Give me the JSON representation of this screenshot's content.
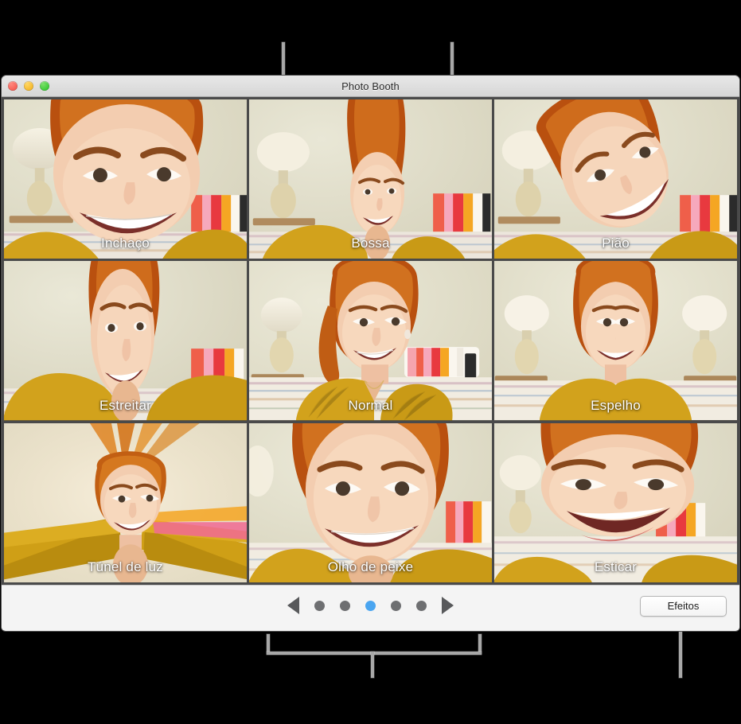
{
  "window": {
    "title": "Photo Booth",
    "controls": [
      "close",
      "minimize",
      "maximize"
    ]
  },
  "effects": [
    {
      "label": "Inchaço",
      "position": "row1-col1",
      "selected": false
    },
    {
      "label": "Bossa",
      "position": "row1-col2",
      "selected": false
    },
    {
      "label": "Pião",
      "position": "row1-col3",
      "selected": false
    },
    {
      "label": "Estreitar",
      "position": "row2-col1",
      "selected": false
    },
    {
      "label": "Normal",
      "position": "row2-col2",
      "selected": true
    },
    {
      "label": "Espelho",
      "position": "row2-col3",
      "selected": false
    },
    {
      "label": "Túnel de luz",
      "position": "row3-col1",
      "selected": false
    },
    {
      "label": "Olho de peixe",
      "position": "row3-col2",
      "selected": false
    },
    {
      "label": "Esticar",
      "position": "row3-col3",
      "selected": false
    }
  ],
  "toolbar": {
    "effects_label": "Efeitos",
    "pager": {
      "previous_arrow": "previous-page-arrow-icon",
      "next_arrow": "next-page-arrow-icon",
      "total_pages": 5,
      "current_page": 3,
      "active_dot_color": "#4aa5f0",
      "inactive_dot_color": "#6e6f71"
    }
  },
  "annotations": {
    "callout_color": "#a8a8a8",
    "lines": [
      {
        "name": "callout-line-toolbar-top",
        "orientation": "vertical"
      },
      {
        "name": "callout-line-selected-effect",
        "orientation": "vertical"
      },
      {
        "name": "callout-bracket-bar",
        "orientation": "bracket"
      },
      {
        "name": "callout-line-effects-button",
        "orientation": "vertical"
      }
    ]
  },
  "colors": {
    "background": "#000000",
    "window_chrome": "#f2f2f2",
    "grid_separator": "#4a4a4a",
    "toolbar": "#f4f4f4",
    "label_text": "#ffffff",
    "accent": "#4aa5f0"
  }
}
